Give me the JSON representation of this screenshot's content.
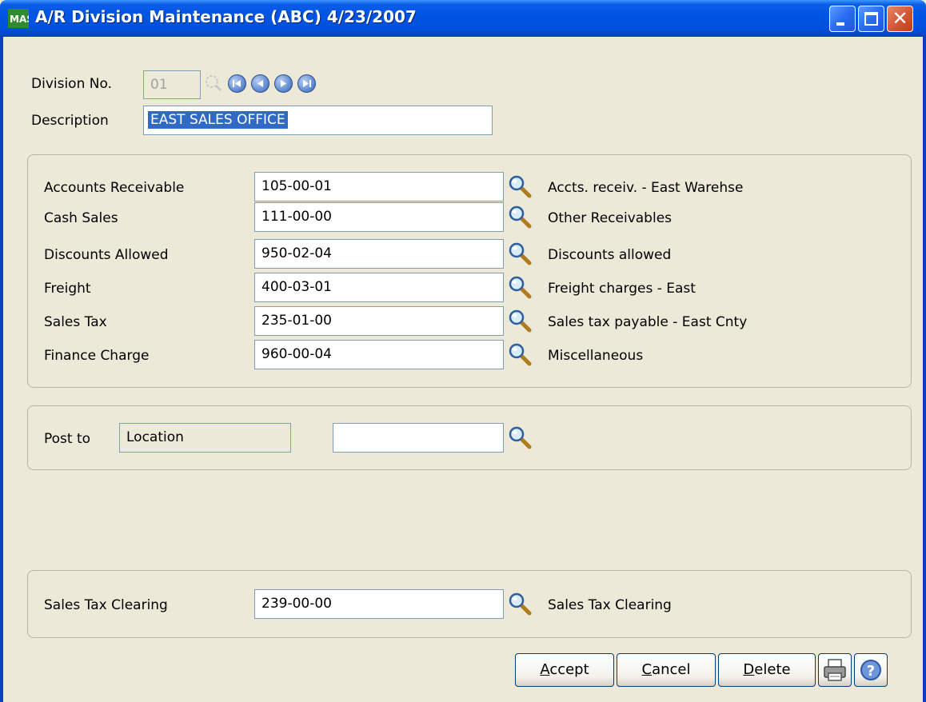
{
  "window": {
    "title": "A/R Division Maintenance (ABC) 4/23/2007",
    "app_icon_text": "MAS"
  },
  "header": {
    "division_label": "Division No.",
    "division_value": "01",
    "description_label": "Description",
    "description_value": "EAST SALES OFFICE"
  },
  "accounts": [
    {
      "label": "Accounts Receivable",
      "value": "105-00-01",
      "description": "Accts. receiv. - East Warehse"
    },
    {
      "label": "Cash Sales",
      "value": "111-00-00",
      "description": "Other Receivables"
    },
    {
      "label": "Discounts Allowed",
      "value": "950-02-04",
      "description": "Discounts allowed"
    },
    {
      "label": "Freight",
      "value": "400-03-01",
      "description": "Freight charges - East"
    },
    {
      "label": "Sales Tax",
      "value": "235-01-00",
      "description": "Sales tax payable - East Cnty"
    },
    {
      "label": "Finance Charge",
      "value": "960-00-04",
      "description": "Miscellaneous"
    }
  ],
  "post_to": {
    "label": "Post to",
    "value": "Location",
    "second_value": ""
  },
  "sales_tax_clearing": {
    "label": "Sales Tax Clearing",
    "value": "239-00-00",
    "description": "Sales Tax Clearing"
  },
  "buttons": {
    "accept_hotkey": "A",
    "accept_rest": "ccept",
    "cancel_hotkey": "C",
    "cancel_rest": "ancel",
    "delete_hotkey": "D",
    "delete_rest": "elete"
  },
  "colors": {
    "titlebar": "#0054e3",
    "face": "#ece9d8",
    "selection": "#316ac5"
  }
}
